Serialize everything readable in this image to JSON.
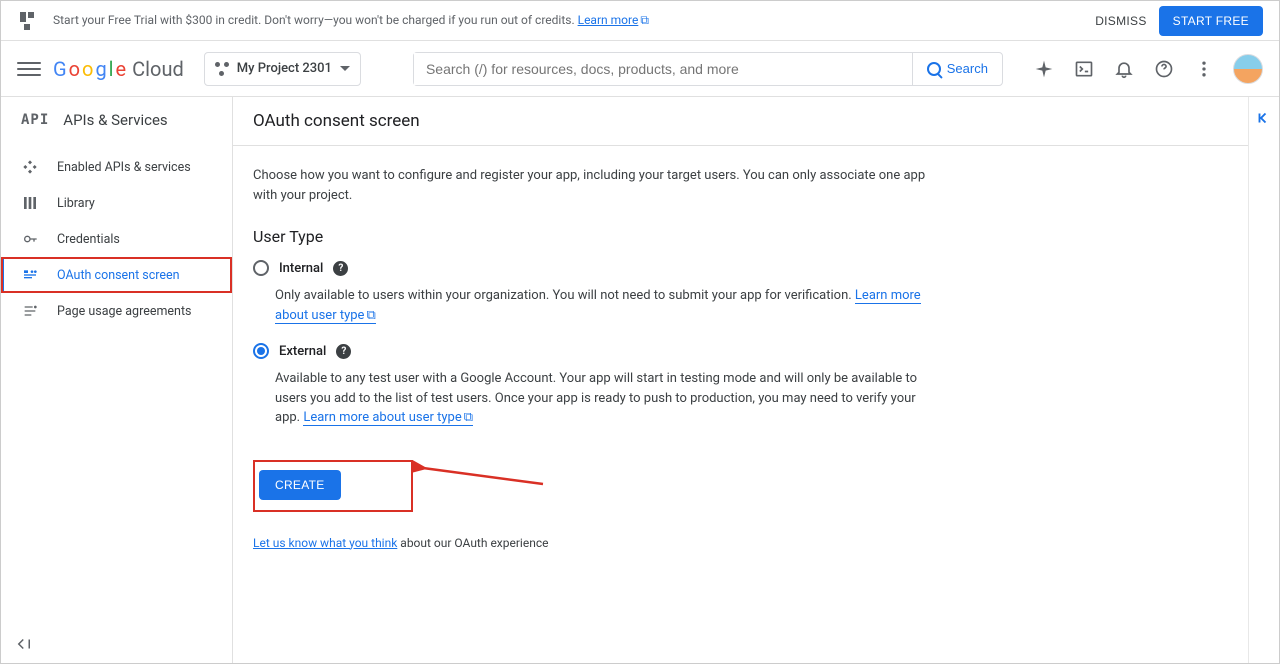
{
  "banner": {
    "message_pre": "Start your Free Trial with $300 in credit. Don't worry—you won't be charged if you run out of credits. ",
    "learn_more": "Learn more",
    "dismiss": "DISMISS",
    "start_free": "START FREE"
  },
  "header": {
    "logo_cloud": "Cloud",
    "project_name": "My Project 2301",
    "search_placeholder": "Search (/) for resources, docs, products, and more",
    "search_button": "Search"
  },
  "sidebar": {
    "section_label": "APIs & Services",
    "items": [
      {
        "label": "Enabled APIs & services"
      },
      {
        "label": "Library"
      },
      {
        "label": "Credentials"
      },
      {
        "label": "OAuth consent screen"
      },
      {
        "label": "Page usage agreements"
      }
    ]
  },
  "page": {
    "title": "OAuth consent screen",
    "intro": "Choose how you want to configure and register your app, including your target users. You can only associate one app with your project.",
    "user_type_heading": "User Type",
    "internal": {
      "label": "Internal",
      "desc_pre": "Only available to users within your organization. You will not need to submit your app for verification. ",
      "learn_more": "Learn more about user type"
    },
    "external": {
      "label": "External",
      "desc_pre": "Available to any test user with a Google Account. Your app will start in testing mode and will only be available to users you add to the list of test users. Once your app is ready to push to production, you may need to verify your app. ",
      "learn_more": "Learn more about user type"
    },
    "create_button": "CREATE",
    "feedback_link": "Let us know what you think",
    "feedback_rest": " about our OAuth experience"
  }
}
